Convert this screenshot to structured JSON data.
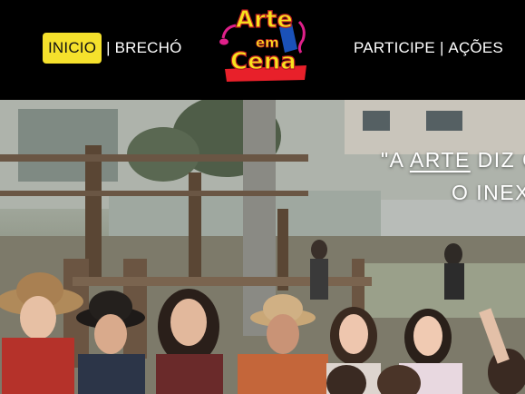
{
  "nav": {
    "left": [
      {
        "label": "INICIO",
        "active": true
      },
      {
        "label": "BRECHÓ",
        "active": false
      }
    ],
    "right": [
      {
        "label": "PARTICIPE",
        "active": false
      },
      {
        "label": "AÇÕES",
        "active": false
      }
    ],
    "separator": "|"
  },
  "logo": {
    "line1": "Arte",
    "line2": "em",
    "line3": "Cena",
    "colors": {
      "yellow": "#f7e21e",
      "red": "#e8202a",
      "pink": "#e0208a",
      "blue": "#1e5fd8"
    }
  },
  "hero": {
    "quote_prefix": "\"A ",
    "quote_emph": "ARTE",
    "quote_suffix": " DIZ O",
    "quote_line2": "O INEX"
  },
  "colors": {
    "header_bg": "#000000",
    "active_bg": "#f5e12c",
    "nav_text": "#ffffff"
  }
}
